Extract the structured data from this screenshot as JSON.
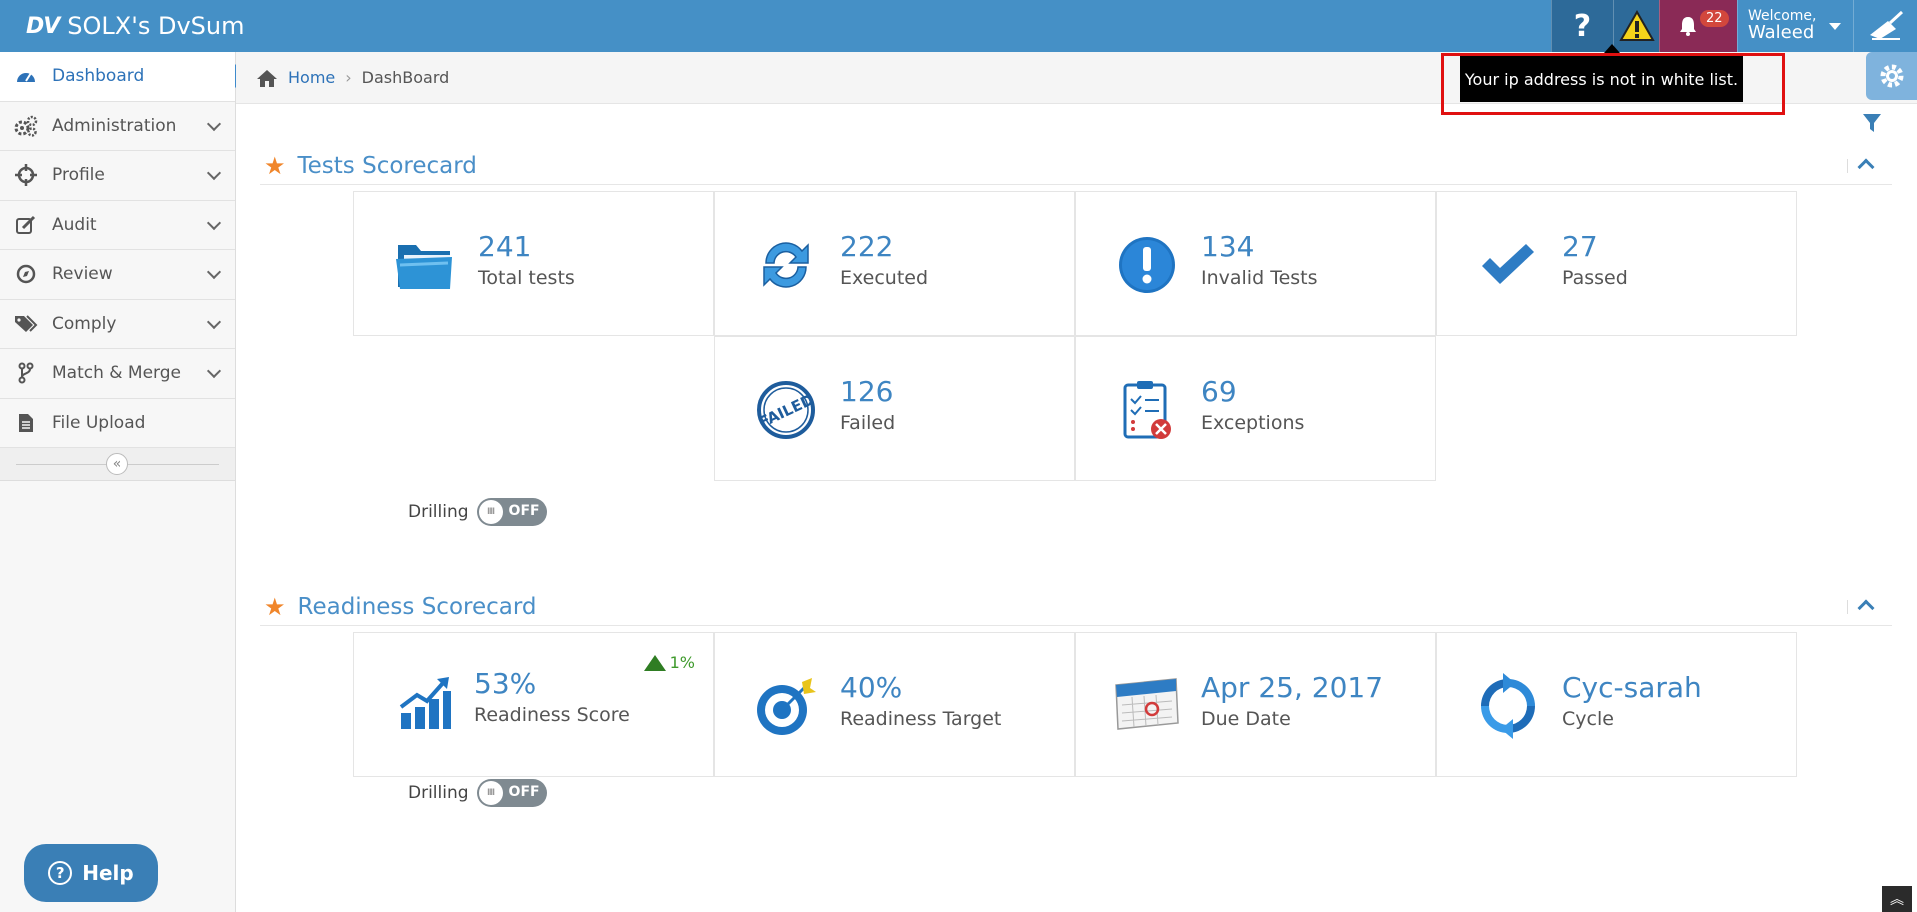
{
  "header": {
    "logo_mark": "DV",
    "title": "SOLX's DvSum",
    "help_glyph": "?",
    "notification_count": "22",
    "welcome_label": "Welcome,",
    "user_name": "Waleed"
  },
  "sidebar": {
    "items": [
      {
        "label": "Dashboard",
        "icon": "dashboard-icon"
      },
      {
        "label": "Administration",
        "icon": "gears-icon"
      },
      {
        "label": "Profile",
        "icon": "crosshair-icon"
      },
      {
        "label": "Audit",
        "icon": "edit-icon"
      },
      {
        "label": "Review",
        "icon": "compass-icon"
      },
      {
        "label": "Comply",
        "icon": "tags-icon"
      },
      {
        "label": "Match & Merge",
        "icon": "fork-icon"
      },
      {
        "label": "File Upload",
        "icon": "file-icon"
      }
    ],
    "help_label": "Help"
  },
  "breadcrumb": {
    "home": "Home",
    "current": "DashBoard"
  },
  "tooltip": {
    "message": "Your ip address is not in white list."
  },
  "tests_scorecard": {
    "title": "Tests Scorecard",
    "cards": [
      {
        "value": "241",
        "label": "Total tests",
        "icon": "folder-icon"
      },
      {
        "value": "222",
        "label": "Executed",
        "icon": "refresh-icon"
      },
      {
        "value": "134",
        "label": "Invalid Tests",
        "icon": "exclamation-icon"
      },
      {
        "value": "27",
        "label": "Passed",
        "icon": "checkmark-icon"
      },
      {
        "value": "126",
        "label": "Failed",
        "icon": "failed-stamp-icon"
      },
      {
        "value": "69",
        "label": "Exceptions",
        "icon": "clipboard-error-icon"
      }
    ],
    "drilling_label": "Drilling",
    "drilling_state": "OFF"
  },
  "readiness_scorecard": {
    "title": "Readiness Scorecard",
    "cards": [
      {
        "value": "53%",
        "label": "Readiness Score",
        "icon": "growth-chart-icon",
        "trend": "1%"
      },
      {
        "value": "40%",
        "label": "Readiness Target",
        "icon": "target-icon"
      },
      {
        "value": "Apr 25, 2017",
        "label": "Due Date",
        "icon": "calendar-icon"
      },
      {
        "value": "Cyc-sarah",
        "label": "Cycle",
        "icon": "cycle-icon"
      }
    ],
    "drilling_label": "Drilling",
    "drilling_state": "OFF"
  },
  "colors": {
    "topbar": "#4590c6",
    "accent": "#3e85c2",
    "star": "#f0862b",
    "notification_bg": "#8a2a56"
  }
}
